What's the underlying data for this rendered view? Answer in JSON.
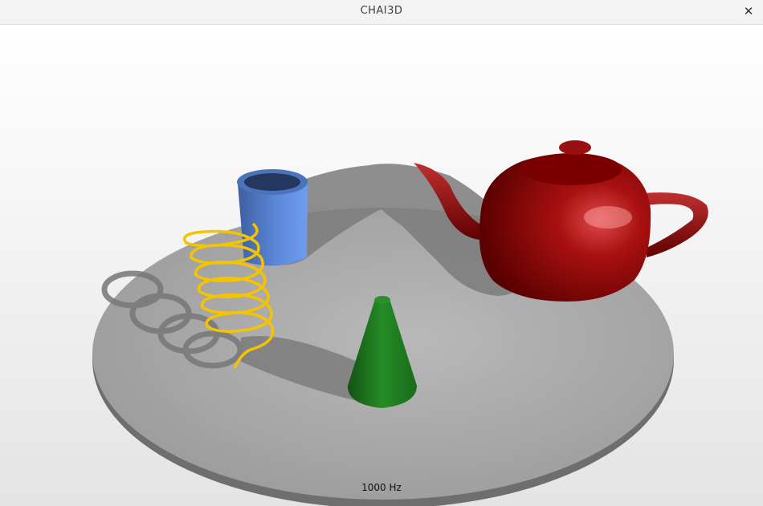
{
  "window": {
    "title": "CHAI3D",
    "close_icon": "close-icon"
  },
  "viewport": {
    "haptic_rate_label": "1000 Hz"
  },
  "scene": {
    "objects": [
      "base-disc",
      "teapot",
      "cylinder",
      "spring",
      "cone"
    ],
    "colors": {
      "background_top": "#ffffff",
      "background_bottom": "#e4e4e4",
      "disc": "#a8a8a8",
      "teapot": "#9a0a0a",
      "cylinder": "#4f7ccc",
      "spring": "#f2c200",
      "cone": "#1f7a1f"
    }
  }
}
